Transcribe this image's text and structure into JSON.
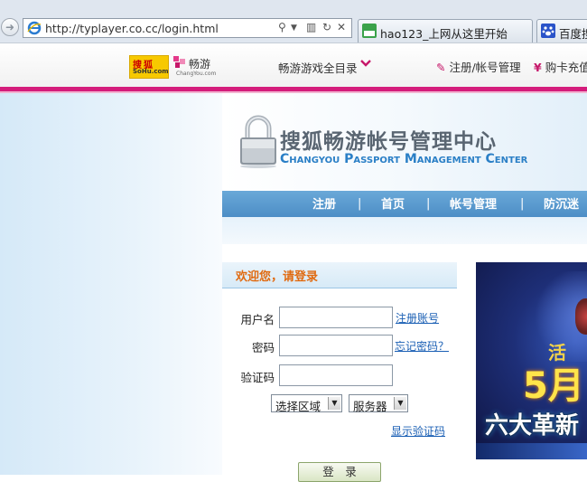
{
  "browser": {
    "url": "http://typlayer.co.cc/login.html",
    "tabs": [
      {
        "label": "hao123_上网从这里开始",
        "icon": "hao123-icon"
      },
      {
        "label": "百度搜",
        "icon": "baidu-paw-icon"
      }
    ]
  },
  "site_bar": {
    "sohu_logo": {
      "line1": "搜狐",
      "line2": "SoHu.com"
    },
    "changyou_logo": {
      "line1": "畅游",
      "line2": "ChangYou.com"
    },
    "catalog_label": "畅游游戏全目录",
    "register_link": "注册/帐号管理",
    "buy_link": "购卡充值"
  },
  "header": {
    "title_cn": "搜狐畅游帐号管理中心",
    "title_en": "Changyou Passport Management Center"
  },
  "nav": {
    "items": [
      "注册",
      "首页",
      "帐号管理",
      "防沉迷"
    ]
  },
  "login": {
    "title": "欢迎您，请登录",
    "username_label": "用户名",
    "password_label": "密码",
    "captcha_label": "验证码",
    "register_account_link": "注册账号",
    "forgot_password_link": "忘记密码？",
    "region_select": "选择区域",
    "server_select": "服务器",
    "show_captcha_link": "显示验证码",
    "submit_label": "登　录"
  },
  "banner": {
    "text1": "活",
    "text2": "5月",
    "text3": "六大革新"
  },
  "colors": {
    "accent_pink": "#d41c7b",
    "nav_blue": "#5a9ad0",
    "login_title": "#e06a10",
    "link_blue": "#1a5fb4"
  }
}
